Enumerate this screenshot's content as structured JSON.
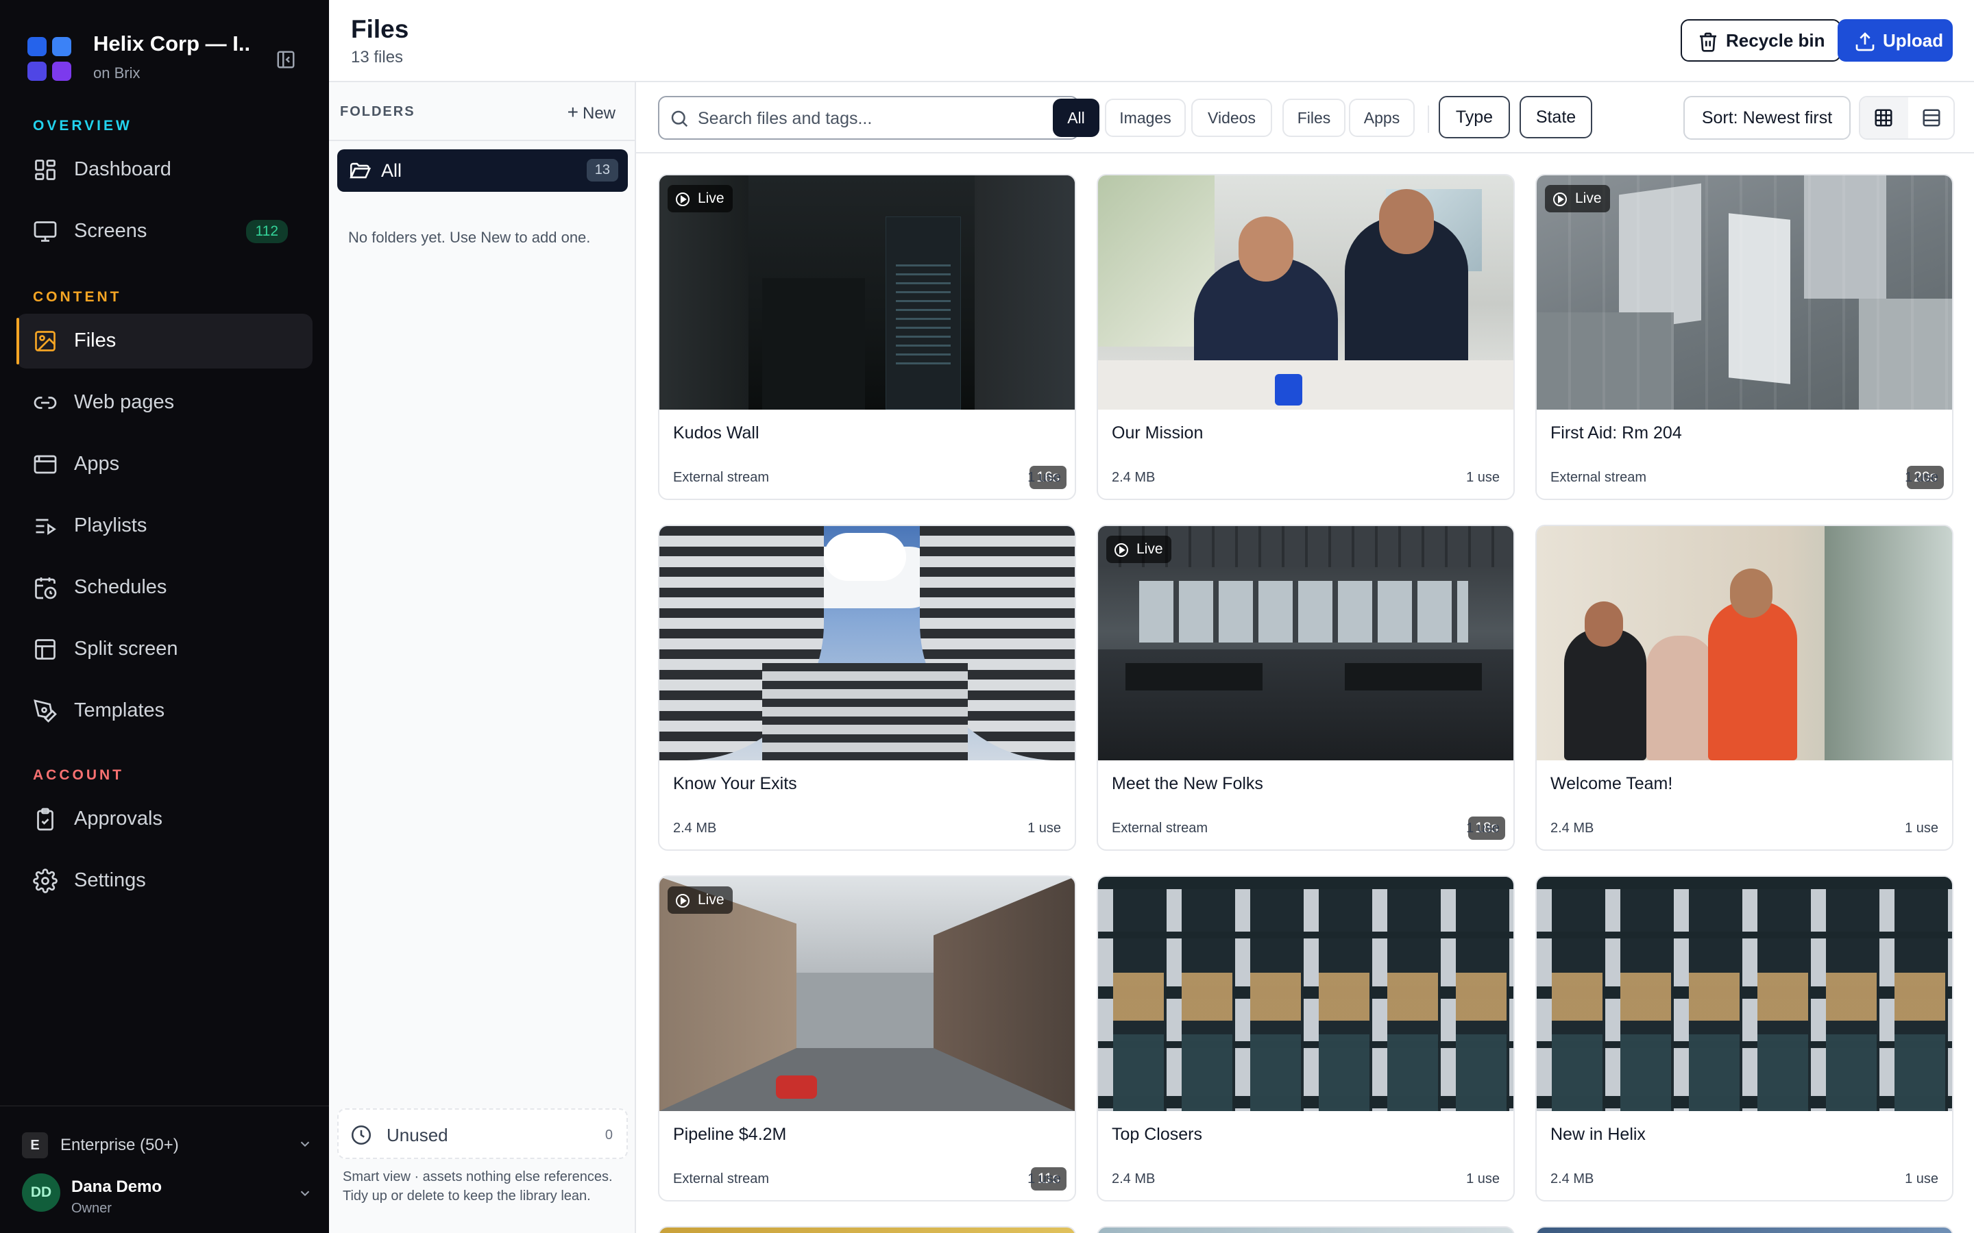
{
  "workspace": {
    "title": "Helix Corp — I...",
    "subtitle": "on Brix"
  },
  "nav": {
    "overview_label": "OVERVIEW",
    "content_label": "CONTENT",
    "account_label": "ACCOUNT",
    "items": [
      {
        "label": "Dashboard",
        "icon": "dashboard-icon"
      },
      {
        "label": "Screens",
        "icon": "monitor-icon",
        "badge": "112"
      },
      {
        "label": "Files",
        "icon": "image-icon",
        "active": true
      },
      {
        "label": "Web pages",
        "icon": "link-icon"
      },
      {
        "label": "Apps",
        "icon": "app-window-icon"
      },
      {
        "label": "Playlists",
        "icon": "playlist-icon"
      },
      {
        "label": "Schedules",
        "icon": "calendar-clock-icon"
      },
      {
        "label": "Split screen",
        "icon": "layout-icon"
      },
      {
        "label": "Templates",
        "icon": "pen-tool-icon"
      },
      {
        "label": "Approvals",
        "icon": "clipboard-check-icon"
      },
      {
        "label": "Settings",
        "icon": "gear-icon"
      }
    ]
  },
  "plan": {
    "badge": "E",
    "label": "Enterprise (50+)"
  },
  "user": {
    "initials": "DD",
    "name": "Dana Demo",
    "role": "Owner"
  },
  "page": {
    "title": "Files",
    "subtitle": "13 files",
    "recycle_label": "Recycle bin",
    "upload_label": "Upload"
  },
  "folders": {
    "heading": "FOLDERS",
    "new_label": "New",
    "all_label": "All",
    "all_count": "13",
    "empty_text": "No folders yet. Use New to add one.",
    "unused_label": "Unused",
    "unused_count": "0",
    "unused_note": "Smart view · assets nothing else references. Tidy up or delete to keep the library lean."
  },
  "toolbar": {
    "search_placeholder": "Search files and tags...",
    "filters": [
      "All",
      "Images",
      "Videos",
      "Files",
      "Apps"
    ],
    "active_filter": "All",
    "type_label": "Type",
    "state_label": "State",
    "sort_label": "Sort: Newest first"
  },
  "colors": {
    "accent": "#1d4ed8",
    "active_marker": "#f5a524",
    "overview": "#22d3ee",
    "content": "#f5a524",
    "account": "#f87171"
  },
  "files": [
    {
      "title": "Kudos Wall",
      "meta": "External stream",
      "uses": "1 use",
      "live": "Live",
      "duration": "16s"
    },
    {
      "title": "Our Mission",
      "meta": "2.4 MB",
      "uses": "1 use"
    },
    {
      "title": "First Aid: Rm 204",
      "meta": "External stream",
      "uses": "1 use",
      "live": "Live",
      "duration": "20s"
    },
    {
      "title": "Know Your Exits",
      "meta": "2.4 MB",
      "uses": "1 use"
    },
    {
      "title": "Meet the New Folks",
      "meta": "External stream",
      "uses": "1 use",
      "live": "Live",
      "duration": "18s"
    },
    {
      "title": "Welcome Team!",
      "meta": "2.4 MB",
      "uses": "1 use"
    },
    {
      "title": "Pipeline $4.2M",
      "meta": "External stream",
      "uses": "1 use",
      "live": "Live",
      "duration": "11s"
    },
    {
      "title": "Top Closers",
      "meta": "2.4 MB",
      "uses": "1 use"
    },
    {
      "title": "New in Helix",
      "meta": "2.4 MB",
      "uses": "1 use"
    }
  ]
}
